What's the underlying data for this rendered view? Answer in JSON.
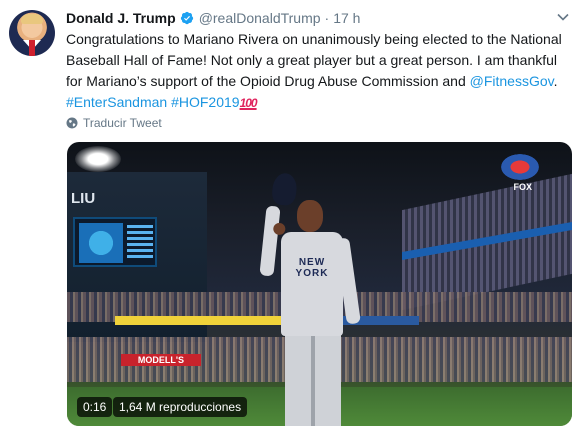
{
  "tweet": {
    "author_name": "Donald J. Trump",
    "handle": "@realDonaldTrump",
    "separator": "·",
    "time": "17 h",
    "text_part1": "Congratulations to Mariano Rivera on unanimously being elected to the National Baseball Hall of Fame! Not only a great player but a great person. I am thankful for Mariano’s support of the Opioid Drug Abuse Commission and ",
    "mention": "@FitnessGov",
    "text_part2": ".",
    "hashtag1": "#EnterSandman",
    "hashtag2": "#HOF2019",
    "emoji_100": "100",
    "translate_label": "Traducir Tweet"
  },
  "video": {
    "duration": "0:16",
    "views": "1,64 M reproducciones",
    "scene_labels": {
      "stadium_sign": "LIU",
      "banner": "MODELL'S",
      "network": "FOX",
      "jersey": "NEW YORK"
    }
  },
  "colors": {
    "link": "#1b95e0",
    "secondary_text": "#657786",
    "primary_text": "#14171a",
    "verified": "#1da1f2",
    "emoji_100": "#e0245e"
  },
  "icons": {
    "verified": "verified-badge-icon",
    "caret": "chevron-down-icon",
    "globe": "globe-icon"
  }
}
